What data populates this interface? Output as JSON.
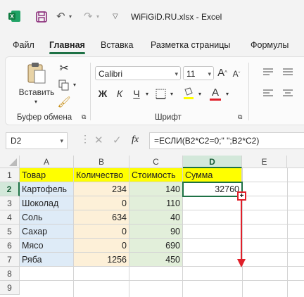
{
  "window": {
    "title": "WiFiGiD.RU.xlsx  -  Excel"
  },
  "tabs": [
    "Файл",
    "Главная",
    "Вставка",
    "Разметка страницы",
    "Формулы"
  ],
  "ribbon": {
    "paste_label": "Вставить",
    "clipboard_group": "Буфер обмена",
    "font_group": "Шрифт",
    "font_name": "Calibri",
    "font_size": "11",
    "bold": "Ж",
    "italic": "К",
    "underline": "Ч",
    "grow_font": "A",
    "shrink_font": "A",
    "font_color_letter": "A"
  },
  "formula_bar": {
    "name_box": "D2",
    "fx": "fx",
    "formula": "=ЕСЛИ(B2*C2=0;\" \";B2*C2)"
  },
  "grid": {
    "columns": [
      "A",
      "B",
      "C",
      "D",
      "E"
    ],
    "rows": [
      "1",
      "2",
      "3",
      "4",
      "5",
      "6",
      "7",
      "8",
      "9"
    ],
    "selected_cell": "D2",
    "headers": [
      "Товар",
      "Количество",
      "Стоимость",
      "Сумма"
    ],
    "data": [
      {
        "name": "Картофель",
        "qty": "234",
        "price": "140",
        "sum": "32760"
      },
      {
        "name": "Шоколад",
        "qty": "0",
        "price": "110",
        "sum": ""
      },
      {
        "name": "Соль",
        "qty": "634",
        "price": "40",
        "sum": ""
      },
      {
        "name": "Сахар",
        "qty": "0",
        "price": "90",
        "sum": ""
      },
      {
        "name": "Мясо",
        "qty": "0",
        "price": "690",
        "sum": ""
      },
      {
        "name": "Ряба",
        "qty": "1256",
        "price": "450",
        "sum": ""
      }
    ]
  },
  "colors": {
    "accent": "#1e7145",
    "annotation": "#e0202a",
    "header_fill": "#ffff00"
  }
}
